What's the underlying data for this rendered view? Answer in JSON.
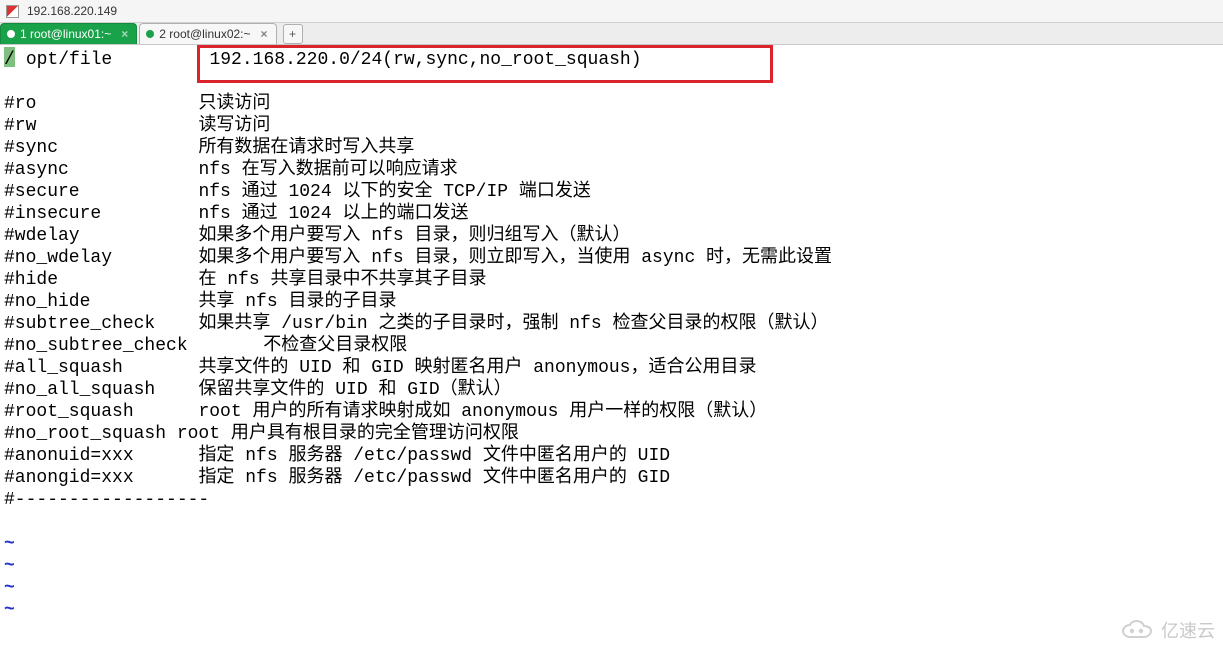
{
  "title": "192.168.220.149",
  "tabs": [
    {
      "label": "1 root@linux01:~",
      "active": true
    },
    {
      "label": "2 root@linux02:~",
      "active": false
    }
  ],
  "highlighted_line": {
    "path": "/opt/file",
    "value": "192.168.220.0/24(rw,sync,no_root_squash)"
  },
  "options": [
    {
      "key": "#ro",
      "desc": "只读访问"
    },
    {
      "key": "#rw",
      "desc": "读写访问"
    },
    {
      "key": "#sync",
      "desc": "所有数据在请求时写入共享"
    },
    {
      "key": "#async",
      "desc": "nfs 在写入数据前可以响应请求"
    },
    {
      "key": "#secure",
      "desc": "nfs 通过 1024 以下的安全 TCP/IP 端口发送"
    },
    {
      "key": "#insecure",
      "desc": "nfs 通过 1024 以上的端口发送"
    },
    {
      "key": "#wdelay",
      "desc": "如果多个用户要写入 nfs 目录，则归组写入（默认）"
    },
    {
      "key": "#no_wdelay",
      "desc": "如果多个用户要写入 nfs 目录，则立即写入，当使用 async 时，无需此设置"
    },
    {
      "key": "#hide",
      "desc": "在 nfs 共享目录中不共享其子目录"
    },
    {
      "key": "#no_hide",
      "desc": "共享 nfs 目录的子目录"
    },
    {
      "key": "#subtree_check",
      "desc": "如果共享 /usr/bin 之类的子目录时，强制 nfs 检查父目录的权限（默认）"
    },
    {
      "key": "#no_subtree_check",
      "desc": "不检查父目录权限",
      "pad": 24
    },
    {
      "key": "#all_squash",
      "desc": "共享文件的 UID 和 GID 映射匿名用户 anonymous，适合公用目录"
    },
    {
      "key": "#no_all_squash",
      "desc": "保留共享文件的 UID 和 GID（默认）"
    },
    {
      "key": "#root_squash",
      "desc": "root 用户的所有请求映射成如 anonymous 用户一样的权限（默认）"
    },
    {
      "key": "#no_root_squash",
      "desc": "root 用户具有根目录的完全管理访问权限",
      "pad": 16
    },
    {
      "key": "#anonuid=xxx",
      "desc": "指定 nfs 服务器 /etc/passwd 文件中匿名用户的 UID"
    },
    {
      "key": "#anongid=xxx",
      "desc": "指定 nfs 服务器 /etc/passwd 文件中匿名用户的 GID"
    }
  ],
  "trailing_line": "#------------------",
  "tilde_count": 4,
  "watermark": "亿速云"
}
